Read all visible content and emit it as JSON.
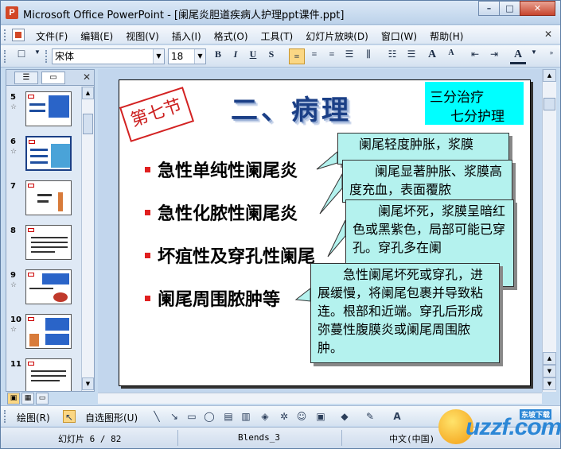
{
  "window": {
    "app_icon": "P",
    "title": "Microsoft Office PowerPoint - [阑尾炎胆道疾病人护理ppt课件.ppt]",
    "minimize": "–",
    "maximize": "□",
    "close": "✕"
  },
  "menu": {
    "items": [
      "文件(F)",
      "编辑(E)",
      "视图(V)",
      "插入(I)",
      "格式(O)",
      "工具(T)",
      "幻灯片放映(D)",
      "窗口(W)",
      "帮助(H)"
    ],
    "close_doc": "✕"
  },
  "toolbar": {
    "font_name": "宋体",
    "font_size": "18",
    "bold": "B",
    "italic": "I",
    "underline": "U",
    "shadow": "S",
    "grow_font": "A",
    "shrink_font": "A",
    "font_color": "A"
  },
  "slide_panel": {
    "tab_outline": "☰",
    "tab_slides": "▭",
    "close": "✕",
    "thumbnails": [
      {
        "number": "5",
        "star": "☆"
      },
      {
        "number": "6",
        "star": "☆"
      },
      {
        "number": "7",
        "star": ""
      },
      {
        "number": "8",
        "star": ""
      },
      {
        "number": "9",
        "star": "☆"
      },
      {
        "number": "10",
        "star": "☆"
      },
      {
        "number": "11",
        "star": ""
      }
    ]
  },
  "slide": {
    "section_stamp": "第七节",
    "title": "二、病理",
    "corner_note": {
      "line1": "三分治疗",
      "line2": "七分护理"
    },
    "bullets": [
      "急性单纯性阑尾炎",
      "急性化脓性阑尾炎",
      "坏疽性及穿孔性阑尾",
      "阑尾周围脓肿等"
    ],
    "callouts": [
      {
        "text": "阑尾轻度肿胀，浆膜"
      },
      {
        "text": "阑尾显著肿胀、浆膜高度充血，表面覆脓"
      },
      {
        "text": "阑尾坏死，浆膜呈暗红色或黑紫色，局部可能已穿孔。穿孔多在阑"
      },
      {
        "text": "急性阑尾坏死或穿孔，进展缓慢，将阑尾包裹并导致粘连。根部和近端。穿孔后形成弥蔓性腹膜炎或阑尾周围脓肿。"
      }
    ]
  },
  "drawbar": {
    "draw": "绘图(R)",
    "autoshapes": "自选图形(U)"
  },
  "status": {
    "slide_pos": "幻灯片 6 / 82",
    "design": "Blends_3",
    "language": "中文(中国)"
  },
  "watermark": {
    "brand": "uzzf.com",
    "tag": "东坡下载"
  }
}
